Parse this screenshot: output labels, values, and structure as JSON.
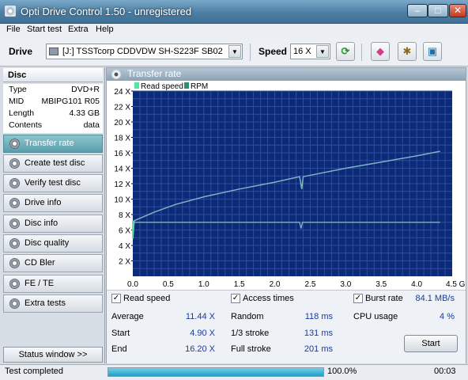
{
  "window": {
    "title": "Opti Drive Control 1.50 - unregistered",
    "minimize": "–",
    "maximize": "□",
    "close": "✕"
  },
  "menu": [
    "File",
    "Start test",
    "Extra",
    "Help"
  ],
  "drivebar": {
    "drive_label": "Drive",
    "drive_value": "[J:]  TSSTcorp CDDVDW SH-S223F SB02",
    "speed_label": "Speed",
    "speed_value": "16 X"
  },
  "disc": {
    "header": "Disc",
    "rows": [
      {
        "k": "Type",
        "v": "DVD+R"
      },
      {
        "k": "MID",
        "v": "MBIPG101 R05"
      },
      {
        "k": "Length",
        "v": "4.33 GB"
      },
      {
        "k": "Contents",
        "v": "data"
      }
    ]
  },
  "nav": [
    "Transfer rate",
    "Create test disc",
    "Verify test disc",
    "Drive info",
    "Disc info",
    "Disc quality",
    "CD Bler",
    "FE / TE",
    "Extra tests"
  ],
  "nav_active": 0,
  "status_window_button": "Status window >>",
  "panel_title": "Transfer rate",
  "chart_data": {
    "type": "line",
    "legend": [
      "Read speed",
      "RPM"
    ],
    "series_colors": {
      "read_speed": "#53e4a6",
      "rpm": "#2e8f70",
      "line": "#7fb3c4"
    },
    "background": "#0c2a78",
    "grid_color": "#2e4f9c",
    "x": {
      "min": 0,
      "max": 4.5,
      "unit": "GB",
      "ticks": [
        "0.0",
        "0.5",
        "1.0",
        "1.5",
        "2.0",
        "2.5",
        "3.0",
        "3.5",
        "4.0",
        "4.5 GB"
      ]
    },
    "y": {
      "min": 0,
      "max": 24,
      "ticks": [
        "2 X",
        "4 X",
        "6 X",
        "8 X",
        "10 X",
        "12 X",
        "14 X",
        "16 X",
        "18 X",
        "20 X",
        "22 X",
        "24 X"
      ]
    },
    "read_speed": [
      [
        0,
        4.9
      ],
      [
        0.02,
        7.2
      ],
      [
        0.3,
        8.3
      ],
      [
        0.6,
        9.3
      ],
      [
        1.0,
        10.3
      ],
      [
        1.5,
        11.3
      ],
      [
        2.0,
        12.2
      ],
      [
        2.35,
        12.9
      ],
      [
        2.38,
        11.3
      ],
      [
        2.4,
        12.9
      ],
      [
        3.0,
        14.0
      ],
      [
        3.5,
        14.8
      ],
      [
        4.0,
        15.6
      ],
      [
        4.33,
        16.2
      ]
    ],
    "rpm": [
      [
        0,
        4.9
      ],
      [
        0.02,
        7.0
      ],
      [
        2.35,
        7.0
      ],
      [
        2.37,
        6.2
      ],
      [
        2.39,
        7.0
      ],
      [
        4.33,
        7.0
      ]
    ]
  },
  "stats": {
    "read_speed": {
      "label": "Read speed",
      "checked": "✓"
    },
    "access_times": {
      "label": "Access times",
      "checked": "✓"
    },
    "burst_rate": {
      "label": "Burst rate",
      "checked": "✓",
      "value": "84.1 MB/s"
    },
    "cpu_usage": {
      "label": "CPU usage",
      "value": "4 %"
    },
    "average": {
      "label": "Average",
      "value": "11.44 X"
    },
    "start": {
      "label": "Start",
      "value": "4.90 X"
    },
    "end": {
      "label": "End",
      "value": "16.20 X"
    },
    "random": {
      "label": "Random",
      "value": "118 ms"
    },
    "third": {
      "label": "1/3 stroke",
      "value": "131 ms"
    },
    "full": {
      "label": "Full stroke",
      "value": "201 ms"
    },
    "start_button": "Start"
  },
  "status": {
    "text": "Test completed",
    "progress_text": "100.0%",
    "progress": 1.0,
    "time": "00:03"
  }
}
